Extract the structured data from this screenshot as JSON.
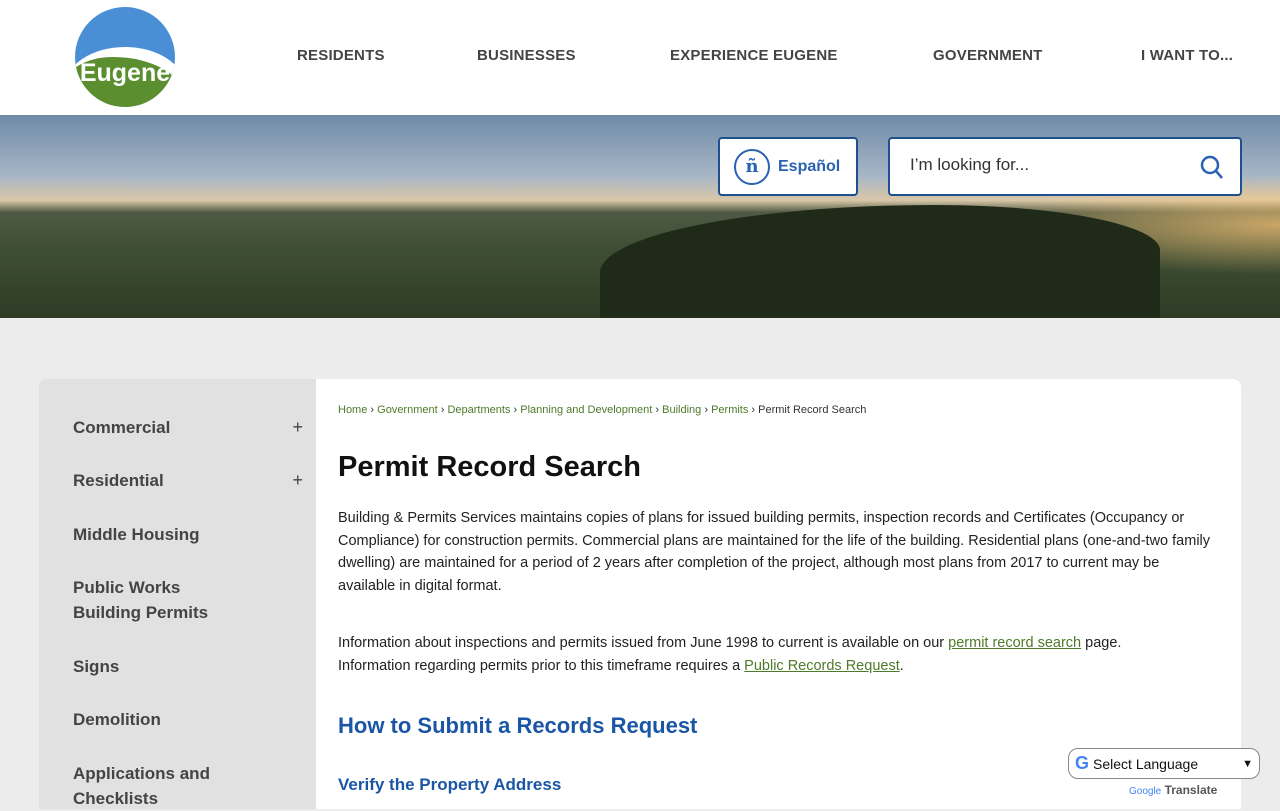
{
  "header": {
    "logo_text": "Eugene",
    "nav": [
      "RESIDENTS",
      "BUSINESSES",
      "EXPERIENCE EUGENE",
      "GOVERNMENT",
      "I WANT TO..."
    ]
  },
  "banner": {
    "espanol": "Español",
    "search_placeholder": "I’m looking for..."
  },
  "sidebar": {
    "items": [
      {
        "label": "Commercial",
        "expand": "+"
      },
      {
        "label": "Residential",
        "expand": "+"
      },
      {
        "label": "Middle Housing"
      },
      {
        "label": "Public Works Building Permits"
      },
      {
        "label": "Signs"
      },
      {
        "label": "Demolition"
      },
      {
        "label": "Applications and Checklists"
      }
    ]
  },
  "breadcrumb": {
    "items": [
      "Home",
      "Government",
      "Departments",
      "Planning and Development",
      "Building",
      "Permits"
    ],
    "current": "Permit Record Search",
    "sep": "›"
  },
  "main": {
    "title": "Permit Record Search",
    "p1": "Building & Permits Services maintains copies of plans for issued building permits, inspection records and Certificates (Occupancy or Compliance) for construction permits. Commercial plans are maintained for the life of the building. Residential plans (one-and-two family dwelling) are maintained for a period of 2 years after completion of the project, although most plans from 2017 to current may be available in digital format.",
    "p2a": "Information about inspections and permits issued from June 1998 to current is available on our ",
    "p2link": "permit record search",
    "p2b": " page.",
    "p3a": "Information regarding permits prior to this timeframe requires a ",
    "p3link": "Public Records Request",
    "p3b": ".",
    "h2": "How to Submit a Records Request",
    "h3": "Verify the Property Address"
  },
  "translate": {
    "label": "Select Language",
    "google": "Google",
    "translate": "Translate"
  }
}
